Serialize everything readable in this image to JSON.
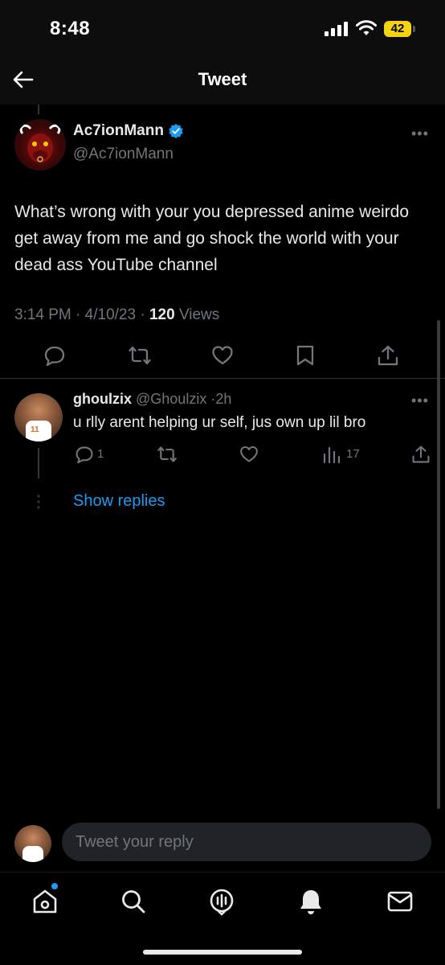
{
  "status_bar": {
    "time": "8:48",
    "battery": "42"
  },
  "nav": {
    "title": "Tweet"
  },
  "main_tweet": {
    "author_name": "Ac7ionMann",
    "author_handle": "@Ac7ionMann",
    "text": "What’s wrong with your you depressed anime weirdo get away from me and go shock the world with your dead ass YouTube channel",
    "time": "3:14 PM",
    "date": "4/10/23",
    "views_count": "120",
    "views_label": "Views"
  },
  "reply": {
    "author_name": "ghoulzix",
    "author_handle": "@Ghoulzix",
    "age": "2h",
    "text": "u rlly arent helping ur self, jus own up lil bro",
    "reply_count": "1",
    "view_count": "17"
  },
  "show_replies": "Show replies",
  "compose": {
    "placeholder": "Tweet your reply"
  },
  "colors": {
    "accent": "#1d9bf0",
    "battery": "#f5d30f",
    "muted": "#71767b"
  },
  "icons": [
    "back-arrow-icon",
    "verified-badge-icon",
    "more-icon",
    "reply-icon",
    "retweet-icon",
    "like-icon",
    "bookmark-icon",
    "share-icon",
    "views-icon",
    "home-icon",
    "search-icon",
    "spaces-icon",
    "notifications-icon",
    "messages-icon"
  ]
}
